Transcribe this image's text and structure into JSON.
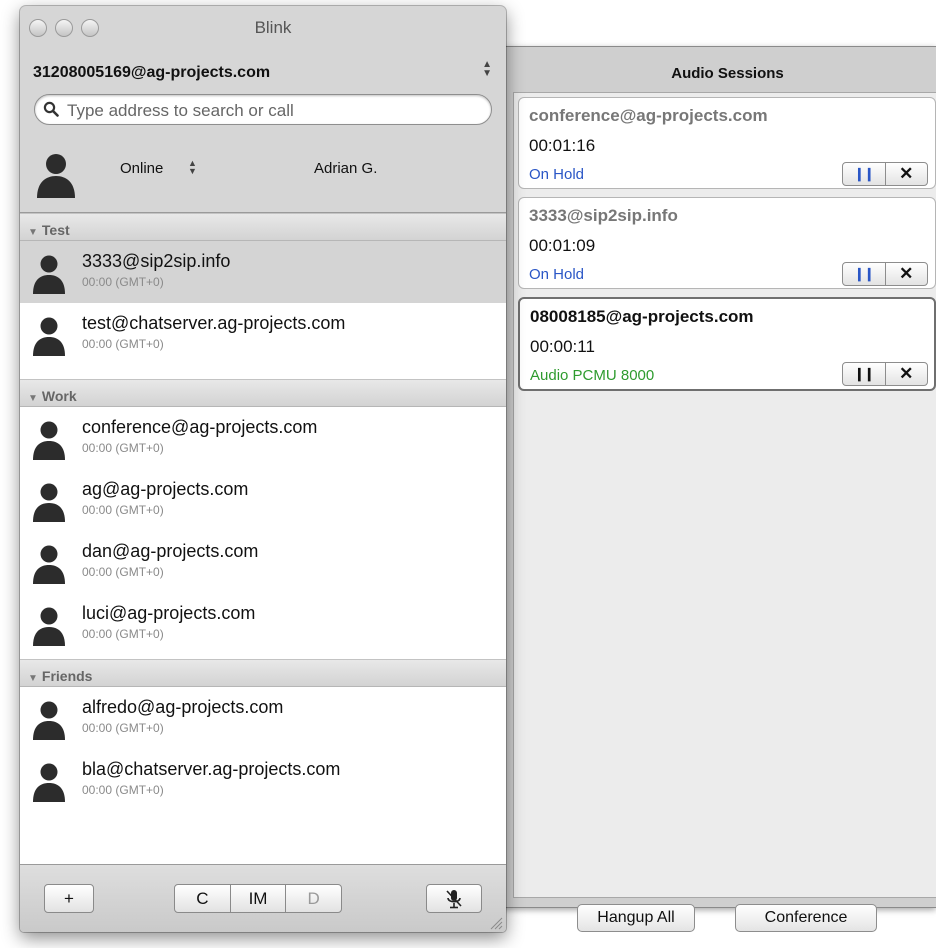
{
  "window": {
    "title": "Blink"
  },
  "account": {
    "address": "31208005169@ag-projects.com"
  },
  "search": {
    "placeholder": "Type address to search or call"
  },
  "presence": {
    "status": "Online",
    "display_name": "Adrian G."
  },
  "groups": [
    {
      "name": "Test",
      "contacts": [
        {
          "name": "3333@sip2sip.info",
          "time": "00:00 (GMT+0)",
          "selected": true
        },
        {
          "name": "test@chatserver.ag-projects.com",
          "time": "00:00 (GMT+0)"
        }
      ]
    },
    {
      "name": "Work",
      "contacts": [
        {
          "name": "conference@ag-projects.com",
          "time": "00:00 (GMT+0)"
        },
        {
          "name": "ag@ag-projects.com",
          "time": "00:00 (GMT+0)"
        },
        {
          "name": "dan@ag-projects.com",
          "time": "00:00 (GMT+0)"
        },
        {
          "name": "luci@ag-projects.com",
          "time": "00:00 (GMT+0)"
        }
      ]
    },
    {
      "name": "Friends",
      "contacts": [
        {
          "name": "alfredo@ag-projects.com",
          "time": "00:00 (GMT+0)"
        },
        {
          "name": "bla@chatserver.ag-projects.com",
          "time": "00:00 (GMT+0)"
        }
      ]
    }
  ],
  "toolbar": {
    "add_label": "+",
    "call_label": "C",
    "im_label": "IM",
    "desktop_label": "D"
  },
  "audio_sessions": {
    "title": "Audio Sessions",
    "sessions": [
      {
        "address": "conference@ag-projects.com",
        "duration": "00:01:16",
        "status": "On Hold"
      },
      {
        "address": "3333@sip2sip.info",
        "duration": "00:01:09",
        "status": "On Hold"
      },
      {
        "address": "08008185@ag-projects.com",
        "duration": "00:00:11",
        "status": "Audio PCMU 8000"
      }
    ],
    "hangup_all_label": "Hangup All",
    "conference_label": "Conference"
  },
  "colors": {
    "on_hold": "#2a56c6",
    "active_codec": "#2e9b2e"
  }
}
